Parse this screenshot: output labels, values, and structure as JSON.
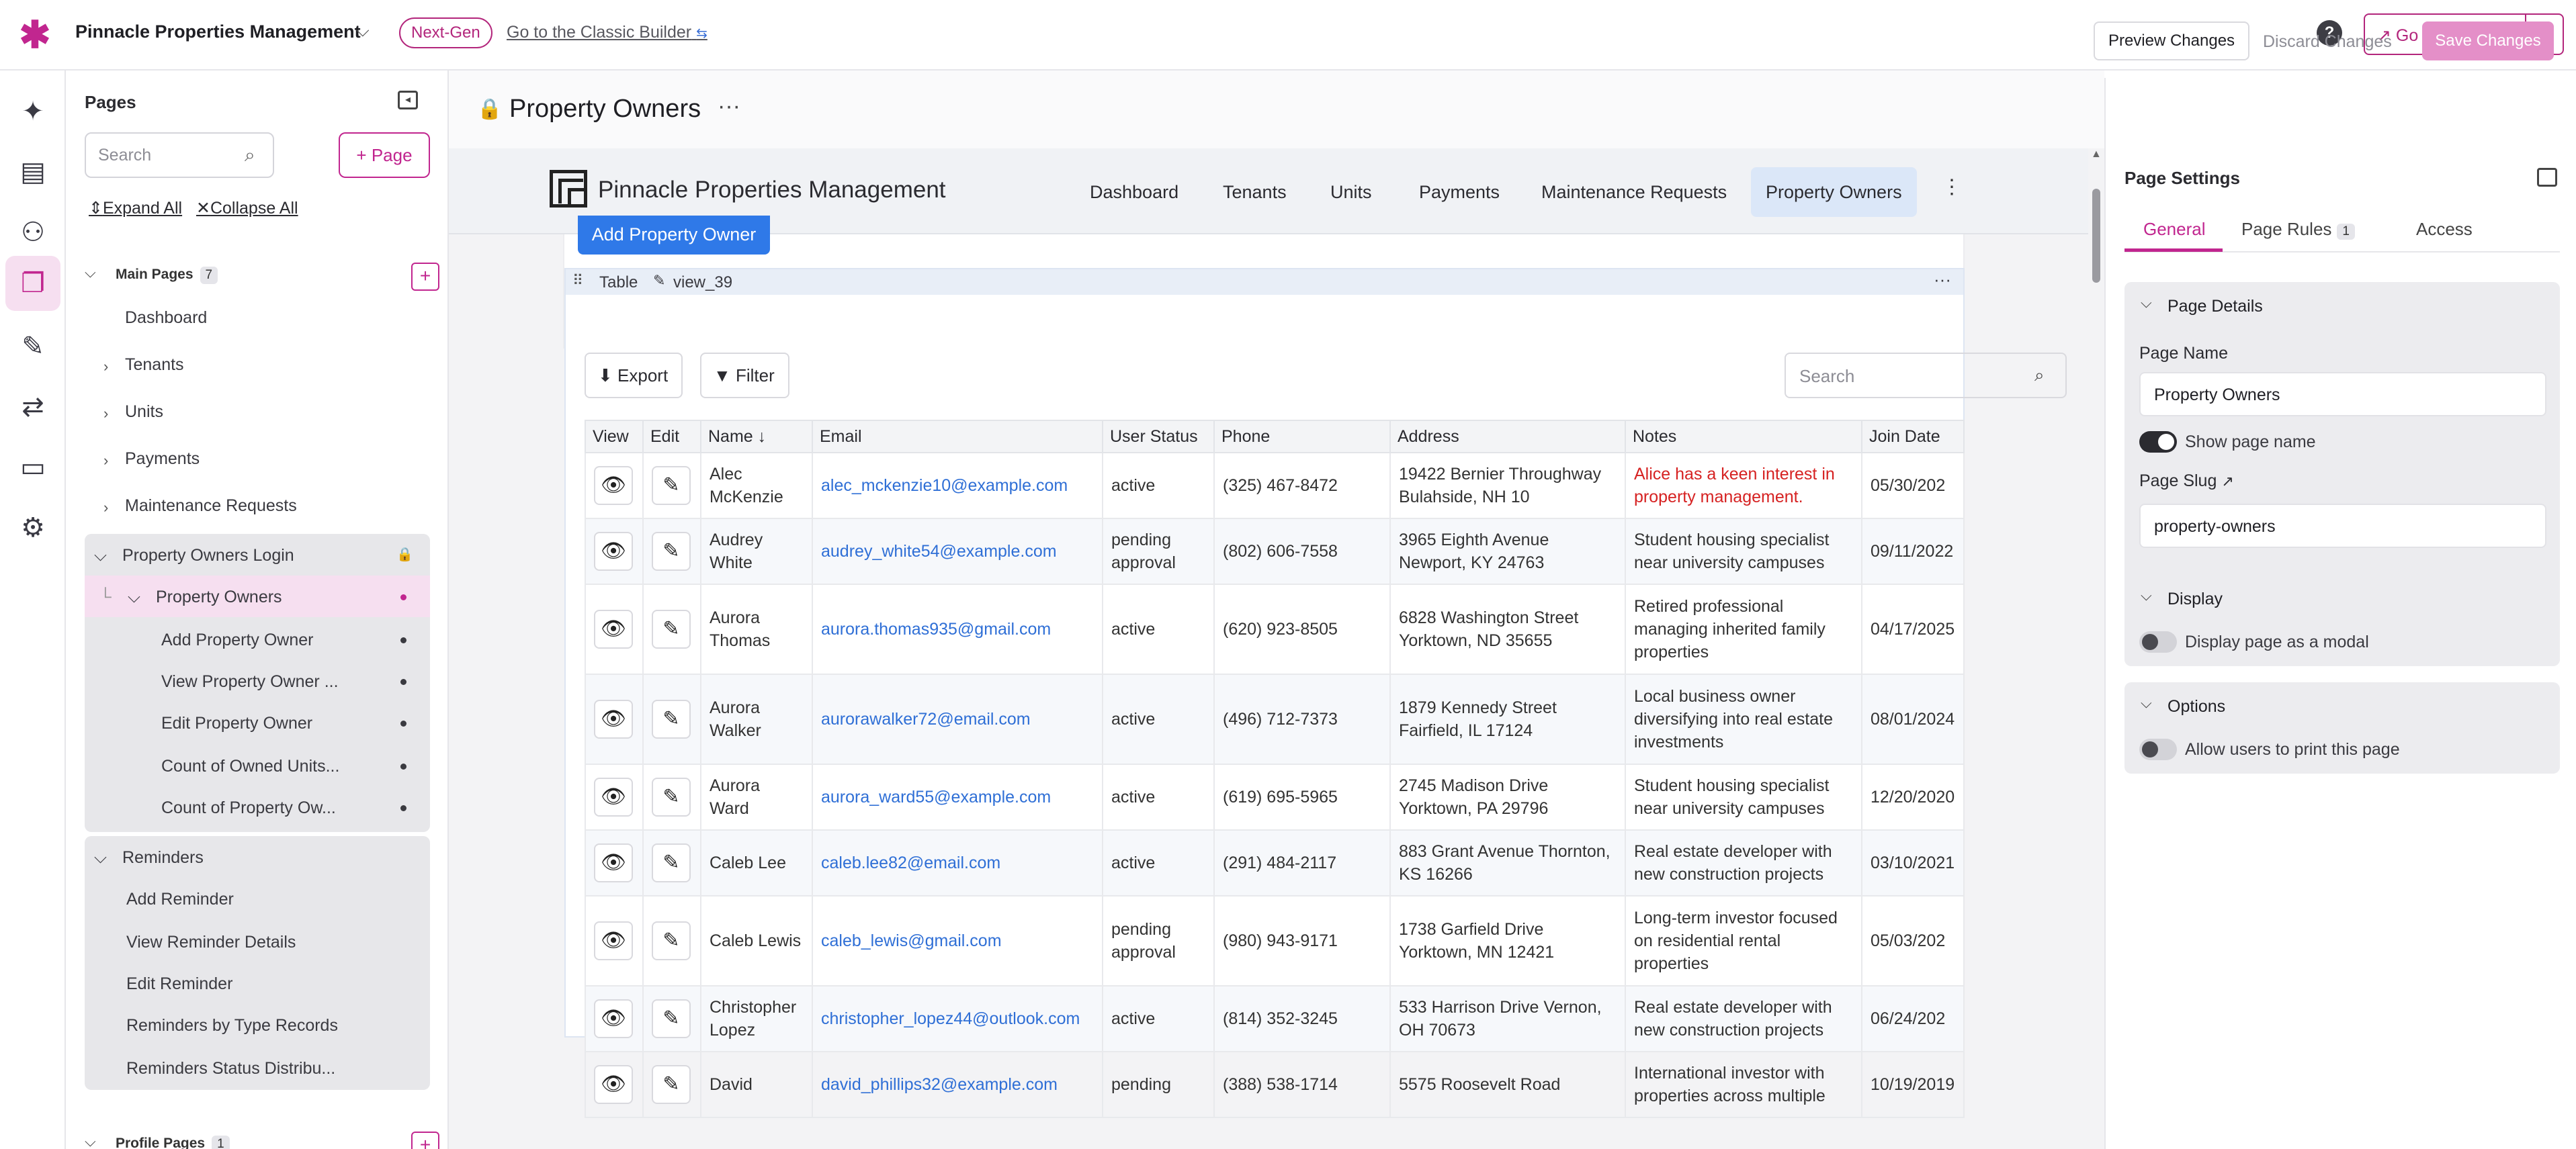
{
  "topbar": {
    "app_title": "Pinnacle Properties Management",
    "badge": "Next-Gen",
    "classic_link": "Go to the Classic Builder",
    "live_app": "Go to Live App"
  },
  "rail": {
    "items": [
      "sparkle-icon",
      "table-icon",
      "users-icon",
      "pages-icon",
      "brush-icon",
      "flow-icon",
      "billing-icon",
      "settings-icon"
    ]
  },
  "pages_panel": {
    "title": "Pages",
    "search_placeholder": "Search",
    "add_page": "+ Page",
    "expand_all": "Expand All",
    "collapse_all": "Collapse All",
    "main_pages": {
      "label": "Main Pages",
      "count": "7"
    },
    "main_items": [
      "Dashboard",
      "Tenants",
      "Units",
      "Payments",
      "Maintenance Requests"
    ],
    "owners_login": "Property Owners Login",
    "owners": "Property Owners",
    "owners_children": [
      "Add Property Owner",
      "View Property Owner ...",
      "Edit Property Owner",
      "Count of Owned Units...",
      "Count of Property Ow..."
    ],
    "reminders": "Reminders",
    "reminders_children": [
      "Add Reminder",
      "View Reminder Details",
      "Edit Reminder",
      "Reminders by Type Records",
      "Reminders Status Distribu..."
    ],
    "profile_pages": {
      "label": "Profile Pages",
      "count": "1"
    }
  },
  "page_header": {
    "title": "Property Owners",
    "preview": "Preview Changes",
    "discard": "Discard Changes",
    "save": "Save Changes"
  },
  "app_nav": {
    "name": "Pinnacle Properties Management",
    "tabs": [
      "Dashboard",
      "Tenants",
      "Units",
      "Payments",
      "Maintenance Requests",
      "Property Owners"
    ]
  },
  "content": {
    "add_button": "Add Property Owner",
    "view_label": "Table",
    "view_key": "view_39",
    "export": "Export",
    "filter": "Filter",
    "search_placeholder": "Search"
  },
  "table": {
    "columns": [
      "View",
      "Edit",
      "Name",
      "Email",
      "User Status",
      "Phone",
      "Address",
      "Notes",
      "Join Date"
    ],
    "rows": [
      {
        "name": "Alec McKenzie",
        "email": "alec_mckenzie10@example.com",
        "status": "active",
        "phone": "(325) 467-8472",
        "address": "19422 Bernier Throughway Bulahside, NH 10",
        "notes": "Alice has a keen interest in property management.",
        "date": "05/30/202"
      },
      {
        "name": "Audrey White",
        "email": "audrey_white54@example.com",
        "status": "pending approval",
        "phone": "(802) 606-7558",
        "address": "3965 Eighth Avenue Newport, KY 24763",
        "notes": "Student housing specialist near university campuses",
        "date": "09/11/2022"
      },
      {
        "name": "Aurora Thomas",
        "email": "aurora.thomas935@gmail.com",
        "status": "active",
        "phone": "(620) 923-8505",
        "address": "6828 Washington Street Yorktown, ND 35655",
        "notes": "Retired professional managing inherited family properties",
        "date": "04/17/2025"
      },
      {
        "name": "Aurora Walker",
        "email": "aurorawalker72@email.com",
        "status": "active",
        "phone": "(496) 712-7373",
        "address": "1879 Kennedy Street Fairfield, IL 17124",
        "notes": "Local business owner diversifying into real estate investments",
        "date": "08/01/2024"
      },
      {
        "name": "Aurora Ward",
        "email": "aurora_ward55@example.com",
        "status": "active",
        "phone": "(619) 695-5965",
        "address": "2745 Madison Drive Yorktown, PA 29796",
        "notes": "Student housing specialist near university campuses",
        "date": "12/20/2020"
      },
      {
        "name": "Caleb Lee",
        "email": "caleb.lee82@email.com",
        "status": "active",
        "phone": "(291) 484-2117",
        "address": "883 Grant Avenue Thornton, KS 16266",
        "notes": "Real estate developer with new construction projects",
        "date": "03/10/2021"
      },
      {
        "name": "Caleb Lewis",
        "email": "caleb_lewis@gmail.com",
        "status": "pending approval",
        "phone": "(980) 943-9171",
        "address": "1738 Garfield Drive Yorktown, MN 12421",
        "notes": "Long-term investor focused on residential rental properties",
        "date": "05/03/202"
      },
      {
        "name": "Christopher Lopez",
        "email": "christopher_lopez44@outlook.com",
        "status": "active",
        "phone": "(814) 352-3245",
        "address": "533 Harrison Drive Vernon, OH 70673",
        "notes": "Real estate developer with new construction projects",
        "date": "06/24/202"
      },
      {
        "name": "David",
        "email": "david_phillips32@example.com",
        "status": "pending",
        "phone": "(388) 538-1714",
        "address": "5575 Roosevelt Road",
        "notes": "International investor with properties across multiple",
        "date": "10/19/2019"
      }
    ]
  },
  "settings": {
    "title": "Page Settings",
    "tabs": [
      "General",
      "Page Rules",
      "Access"
    ],
    "page_rules_count": "1",
    "details_head": "Page Details",
    "page_name_label": "Page Name",
    "page_name": "Property Owners",
    "show_name": "Show page name",
    "slug_label": "Page Slug",
    "slug": "property-owners",
    "display_head": "Display",
    "display_modal": "Display page as a modal",
    "options_head": "Options",
    "allow_print": "Allow users to print this page"
  }
}
